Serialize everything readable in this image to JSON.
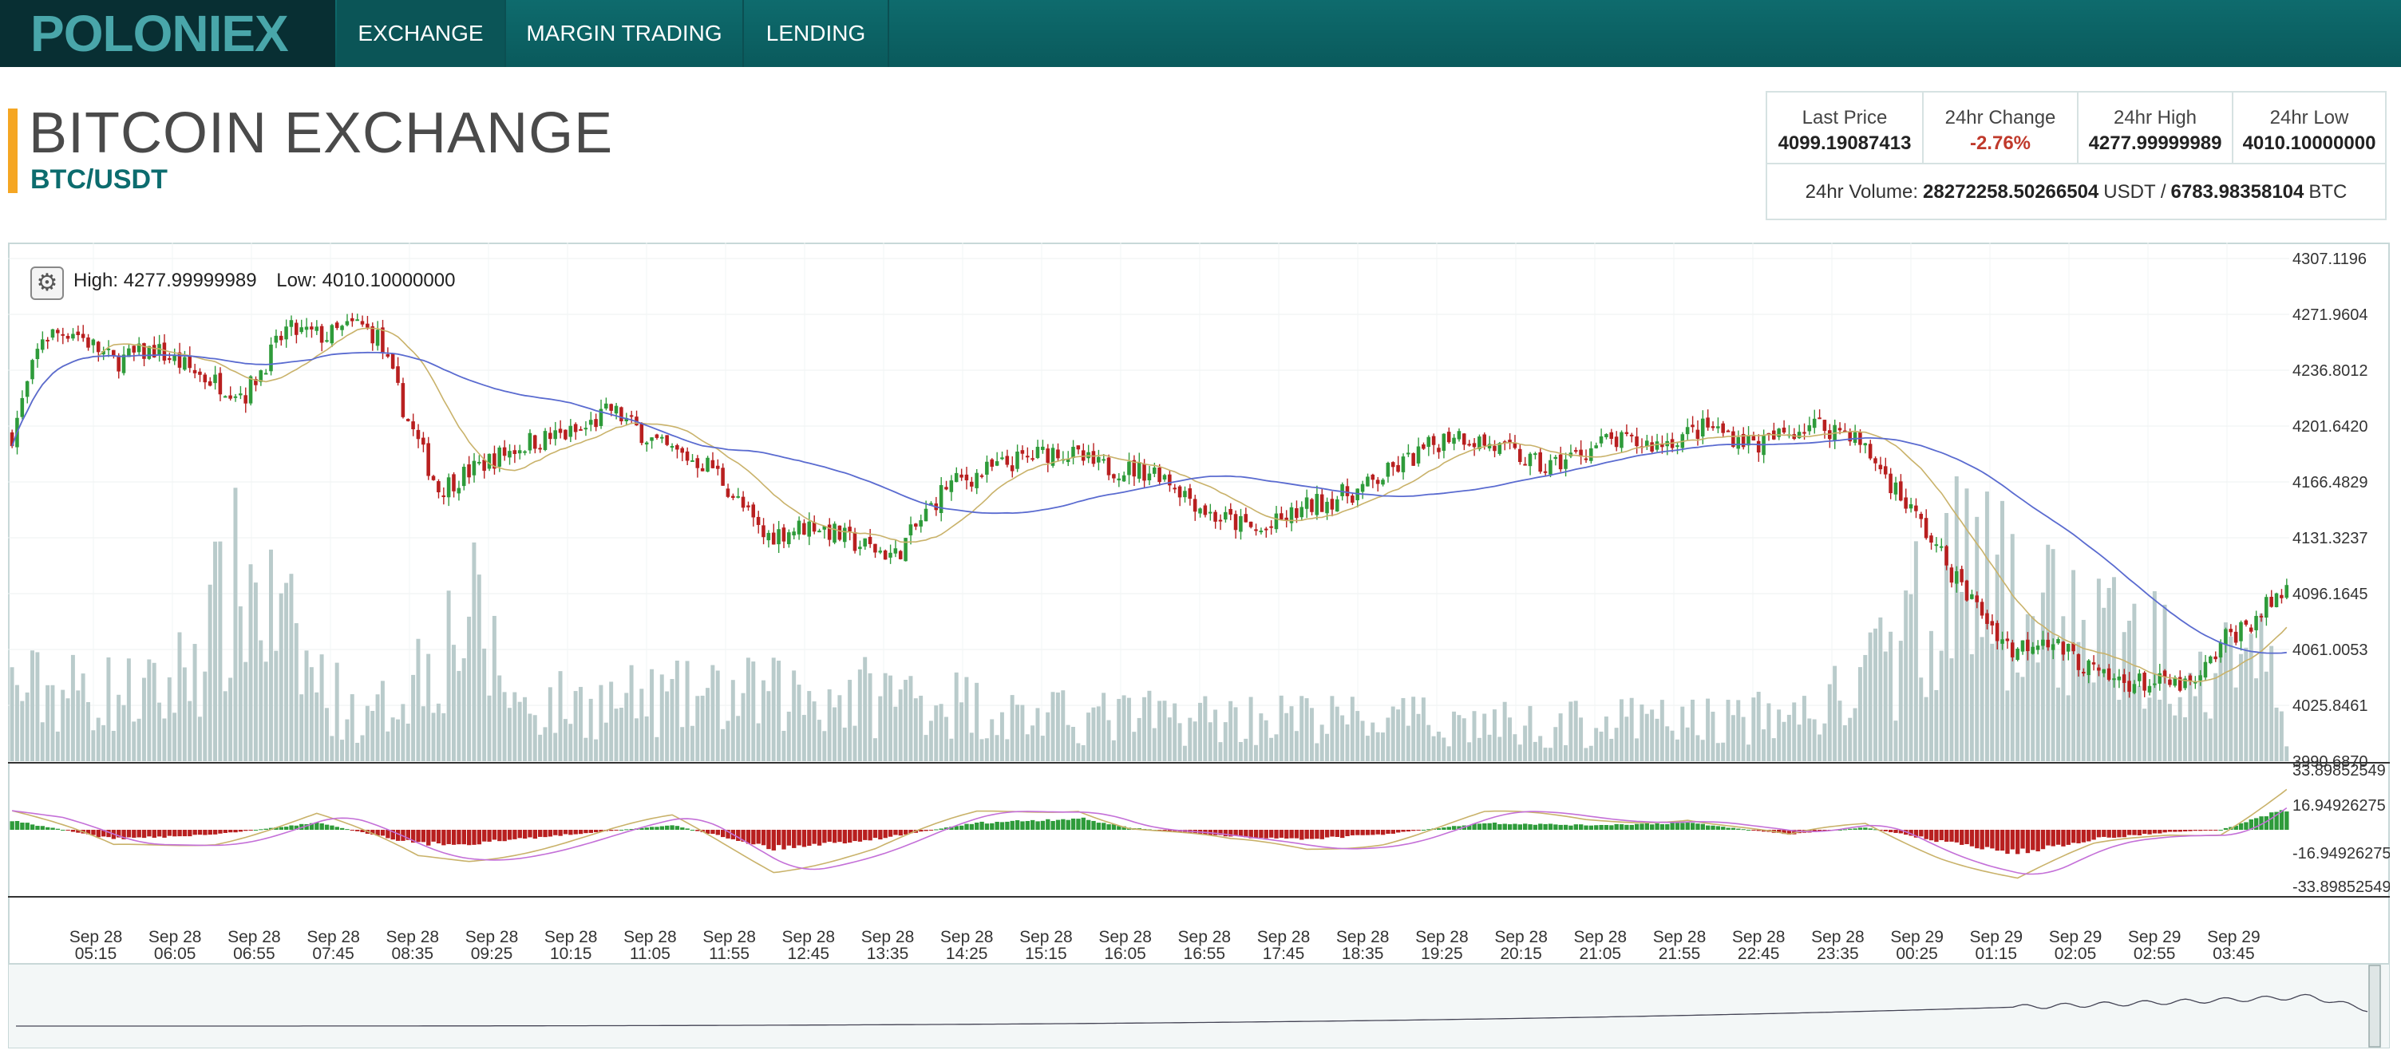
{
  "brand": {
    "logo_text": "POLONIEX",
    "logo_color": "#49a6aa"
  },
  "nav": {
    "tabs": [
      {
        "label": "EXCHANGE",
        "active": true
      },
      {
        "label": "MARGIN TRADING"
      },
      {
        "label": "LENDING"
      }
    ]
  },
  "header": {
    "title": "BITCOIN EXCHANGE",
    "pair": "BTC/USDT"
  },
  "stats": {
    "last_price": {
      "label": "Last Price",
      "value": "4099.19087413"
    },
    "change_24h": {
      "label": "24hr Change",
      "value": "-2.76%",
      "color": "#c0392b"
    },
    "high_24h": {
      "label": "24hr High",
      "value": "4277.99999989"
    },
    "low_24h": {
      "label": "24hr Low",
      "value": "4010.10000000"
    },
    "volume": {
      "label": "24hr Volume:",
      "usdt": "28272258.50266504",
      "usdt_unit": "USDT /",
      "btc": "6783.98358104",
      "btc_unit": "BTC"
    }
  },
  "chart": {
    "settings_icon": "gear-icon",
    "high_label": "High:",
    "high": "4277.99999989",
    "low_label": "Low:",
    "low": "4010.10000000"
  },
  "chart_data": {
    "type": "candlestick",
    "colors": {
      "up": "#2e9b3a",
      "down": "#b81f1f",
      "volume": "#b9cbcb",
      "sma_fast": "#c9b26a",
      "sma_slow": "#5a6bd0",
      "macd_line": "#c9b26a",
      "signal_line": "#c470d8"
    },
    "price_axis": {
      "ylim": [
        3990.687,
        4307.1196
      ],
      "ticks": [
        "4307.1196",
        "4271.9604",
        "4236.8012",
        "4201.6420",
        "4166.4829",
        "4131.3237",
        "4096.1645",
        "4061.0053",
        "4025.8461",
        "3990.6870"
      ]
    },
    "macd_axis": {
      "ticks": [
        "33.89852549",
        "16.94926275",
        "-16.94926275",
        "-33.89852549"
      ]
    },
    "x_ticks": [
      {
        "d": "Sep 28",
        "t": "05:15"
      },
      {
        "d": "Sep 28",
        "t": "06:05"
      },
      {
        "d": "Sep 28",
        "t": "06:55"
      },
      {
        "d": "Sep 28",
        "t": "07:45"
      },
      {
        "d": "Sep 28",
        "t": "08:35"
      },
      {
        "d": "Sep 28",
        "t": "09:25"
      },
      {
        "d": "Sep 28",
        "t": "10:15"
      },
      {
        "d": "Sep 28",
        "t": "11:05"
      },
      {
        "d": "Sep 28",
        "t": "11:55"
      },
      {
        "d": "Sep 28",
        "t": "12:45"
      },
      {
        "d": "Sep 28",
        "t": "13:35"
      },
      {
        "d": "Sep 28",
        "t": "14:25"
      },
      {
        "d": "Sep 28",
        "t": "15:15"
      },
      {
        "d": "Sep 28",
        "t": "16:05"
      },
      {
        "d": "Sep 28",
        "t": "16:55"
      },
      {
        "d": "Sep 28",
        "t": "17:45"
      },
      {
        "d": "Sep 28",
        "t": "18:35"
      },
      {
        "d": "Sep 28",
        "t": "19:25"
      },
      {
        "d": "Sep 28",
        "t": "20:15"
      },
      {
        "d": "Sep 28",
        "t": "21:05"
      },
      {
        "d": "Sep 28",
        "t": "21:55"
      },
      {
        "d": "Sep 28",
        "t": "22:45"
      },
      {
        "d": "Sep 28",
        "t": "23:35"
      },
      {
        "d": "Sep 29",
        "t": "00:25"
      },
      {
        "d": "Sep 29",
        "t": "01:15"
      },
      {
        "d": "Sep 29",
        "t": "02:05"
      },
      {
        "d": "Sep 29",
        "t": "02:55"
      },
      {
        "d": "Sep 29",
        "t": "03:45"
      }
    ],
    "close_keypoints": [
      [
        0,
        4196
      ],
      [
        6,
        4258
      ],
      [
        12,
        4262
      ],
      [
        20,
        4242
      ],
      [
        28,
        4250
      ],
      [
        38,
        4232
      ],
      [
        46,
        4222
      ],
      [
        54,
        4262
      ],
      [
        62,
        4258
      ],
      [
        68,
        4266
      ],
      [
        72,
        4258
      ],
      [
        78,
        4205
      ],
      [
        84,
        4162
      ],
      [
        94,
        4180
      ],
      [
        102,
        4192
      ],
      [
        112,
        4198
      ],
      [
        118,
        4212
      ],
      [
        128,
        4188
      ],
      [
        138,
        4176
      ],
      [
        148,
        4132
      ],
      [
        158,
        4140
      ],
      [
        166,
        4128
      ],
      [
        174,
        4120
      ],
      [
        184,
        4164
      ],
      [
        196,
        4178
      ],
      [
        206,
        4187
      ],
      [
        214,
        4176
      ],
      [
        226,
        4173
      ],
      [
        236,
        4146
      ],
      [
        246,
        4135
      ],
      [
        256,
        4152
      ],
      [
        266,
        4162
      ],
      [
        274,
        4178
      ],
      [
        284,
        4198
      ],
      [
        294,
        4186
      ],
      [
        302,
        4175
      ],
      [
        314,
        4192
      ],
      [
        324,
        4190
      ],
      [
        334,
        4201
      ],
      [
        344,
        4190
      ],
      [
        354,
        4203
      ],
      [
        362,
        4198
      ],
      [
        368,
        4175
      ],
      [
        376,
        4140
      ],
      [
        384,
        4100
      ],
      [
        394,
        4060
      ],
      [
        400,
        4070
      ],
      [
        412,
        4042
      ],
      [
        420,
        4040
      ],
      [
        430,
        4038
      ],
      [
        436,
        4068
      ],
      [
        441,
        4078
      ],
      [
        448,
        4100
      ]
    ],
    "volume_keypoints": [
      [
        0,
        0.2
      ],
      [
        30,
        0.18
      ],
      [
        46,
        0.5
      ],
      [
        60,
        0.22
      ],
      [
        70,
        0.1
      ],
      [
        90,
        0.4
      ],
      [
        100,
        0.15
      ],
      [
        150,
        0.18
      ],
      [
        180,
        0.18
      ],
      [
        200,
        0.12
      ],
      [
        250,
        0.12
      ],
      [
        300,
        0.1
      ],
      [
        350,
        0.12
      ],
      [
        362,
        0.18
      ],
      [
        372,
        0.3
      ],
      [
        380,
        0.55
      ],
      [
        390,
        0.45
      ],
      [
        405,
        0.38
      ],
      [
        420,
        0.3
      ],
      [
        440,
        0.35
      ],
      [
        448,
        0.1
      ]
    ],
    "macd_keypoints": [
      [
        0,
        4
      ],
      [
        20,
        -4
      ],
      [
        40,
        -2
      ],
      [
        60,
        3
      ],
      [
        80,
        -6
      ],
      [
        90,
        -6
      ],
      [
        110,
        -2
      ],
      [
        130,
        2
      ],
      [
        150,
        -8
      ],
      [
        170,
        -4
      ],
      [
        190,
        3
      ],
      [
        210,
        5
      ],
      [
        220,
        1
      ],
      [
        240,
        -3
      ],
      [
        255,
        -4
      ],
      [
        270,
        -2
      ],
      [
        290,
        3
      ],
      [
        310,
        2
      ],
      [
        330,
        3
      ],
      [
        350,
        -2
      ],
      [
        365,
        1
      ],
      [
        380,
        -5
      ],
      [
        395,
        -10
      ],
      [
        410,
        -4
      ],
      [
        425,
        -1
      ],
      [
        435,
        0
      ],
      [
        448,
        9
      ]
    ]
  }
}
